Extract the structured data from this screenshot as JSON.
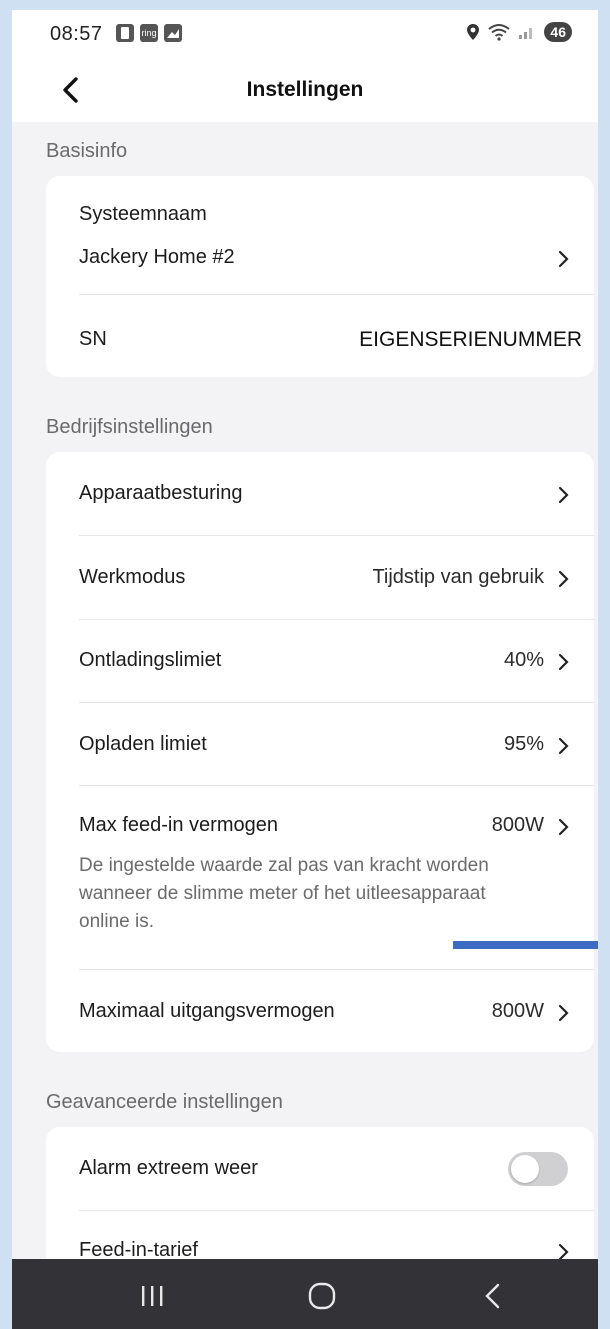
{
  "status_bar": {
    "time": "08:57",
    "battery": "46",
    "notification_icons": [
      "phone-icon",
      "ring-icon",
      "photo-icon"
    ],
    "ring_label": "ring"
  },
  "header": {
    "title": "Instellingen"
  },
  "basisinfo": {
    "title": "Basisinfo",
    "system_name_label": "Systeemnaam",
    "system_name_value": "Jackery Home #2",
    "sn_label": "SN",
    "sn_value": "EIGENSERIENUMMER"
  },
  "operation": {
    "title": "Bedrijfsinstellingen",
    "device_control_label": "Apparaatbesturing",
    "work_mode_label": "Werkmodus",
    "work_mode_value": "Tijdstip van gebruik",
    "discharge_label": "Ontladingslimiet",
    "discharge_value": "40%",
    "charge_label": "Opladen limiet",
    "charge_value": "95%",
    "feedin_label": "Max feed-in vermogen",
    "feedin_value": "800W",
    "feedin_note_line1": "De ingestelde waarde zal pas van kracht worden",
    "feedin_note_line2": "wanneer de slimme meter of het uitleesapparaat",
    "feedin_note_line3": "online is.",
    "max_output_label": "Maximaal uitgangsvermogen",
    "max_output_value": "800W"
  },
  "advanced": {
    "title": "Geavanceerde instellingen",
    "alarm_label": "Alarm extreem weer",
    "alarm_enabled": false,
    "feedin_tariff_label": "Feed-in-tarief"
  },
  "colors": {
    "accent_mark": "#3b6bc2",
    "background": "#f3f3f5",
    "card": "#ffffff",
    "navbar": "#333337"
  }
}
